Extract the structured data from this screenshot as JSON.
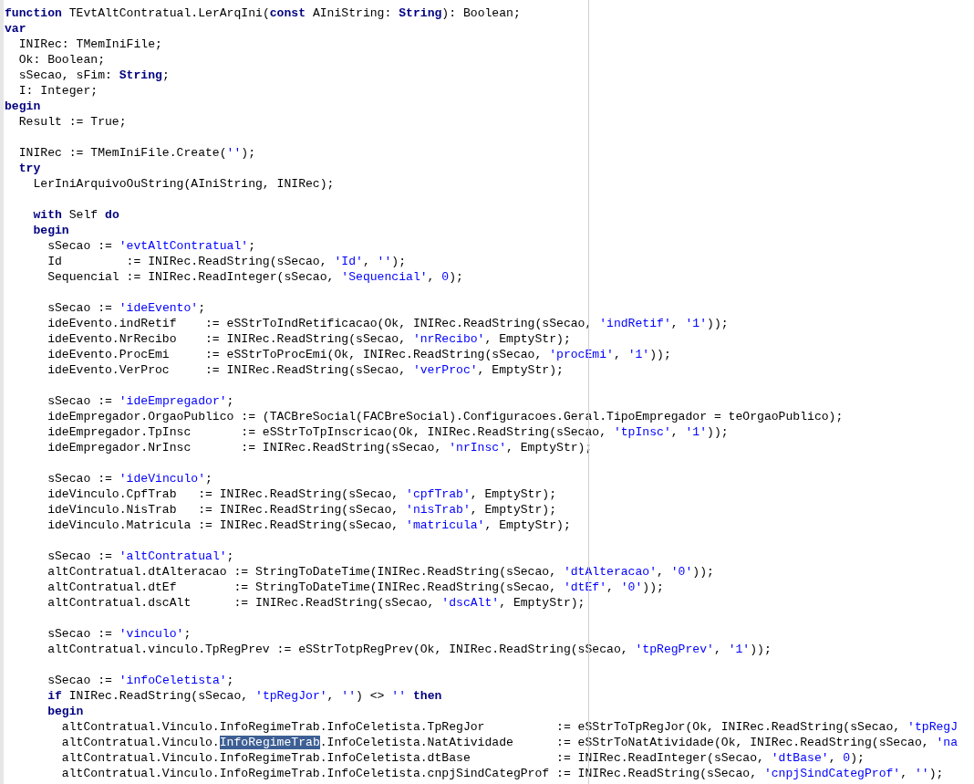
{
  "editor": {
    "lines": [
      {
        "kind": "code",
        "tokens": [
          {
            "kind": "keyword",
            "text": "function"
          },
          {
            "kind": "plain",
            "text": " TEvtAltContratual.LerArqIni("
          },
          {
            "kind": "keyword",
            "text": "const"
          },
          {
            "kind": "plain",
            "text": " AIniString: "
          },
          {
            "kind": "keyword",
            "text": "String"
          },
          {
            "kind": "plain",
            "text": "): Boolean;"
          }
        ]
      },
      {
        "kind": "code",
        "tokens": [
          {
            "kind": "keyword",
            "text": "var"
          }
        ]
      },
      {
        "kind": "code",
        "tokens": [
          {
            "kind": "plain",
            "text": "  INIRec: TMemIniFile;"
          }
        ]
      },
      {
        "kind": "code",
        "tokens": [
          {
            "kind": "plain",
            "text": "  Ok: Boolean;"
          }
        ]
      },
      {
        "kind": "code",
        "tokens": [
          {
            "kind": "plain",
            "text": "  sSecao, sFim: "
          },
          {
            "kind": "keyword",
            "text": "String"
          },
          {
            "kind": "plain",
            "text": ";"
          }
        ]
      },
      {
        "kind": "code",
        "tokens": [
          {
            "kind": "plain",
            "text": "  I: Integer;"
          }
        ]
      },
      {
        "kind": "code",
        "tokens": [
          {
            "kind": "keyword",
            "text": "begin"
          }
        ]
      },
      {
        "kind": "code",
        "tokens": [
          {
            "kind": "plain",
            "text": "  Result := True;"
          }
        ]
      },
      {
        "kind": "blank"
      },
      {
        "kind": "code",
        "tokens": [
          {
            "kind": "plain",
            "text": "  INIRec := TMemIniFile.Create("
          },
          {
            "kind": "string",
            "text": "''"
          },
          {
            "kind": "plain",
            "text": ");"
          }
        ]
      },
      {
        "kind": "code",
        "tokens": [
          {
            "kind": "keyword",
            "text": "  try"
          }
        ]
      },
      {
        "kind": "code",
        "tokens": [
          {
            "kind": "plain",
            "text": "    LerIniArquivoOuString(AIniString, INIRec);"
          }
        ]
      },
      {
        "kind": "blank"
      },
      {
        "kind": "code",
        "tokens": [
          {
            "kind": "keyword",
            "text": "    with"
          },
          {
            "kind": "plain",
            "text": " Self "
          },
          {
            "kind": "keyword",
            "text": "do"
          }
        ]
      },
      {
        "kind": "code",
        "tokens": [
          {
            "kind": "keyword",
            "text": "    begin"
          }
        ]
      },
      {
        "kind": "code",
        "tokens": [
          {
            "kind": "plain",
            "text": "      sSecao := "
          },
          {
            "kind": "string",
            "text": "'evtAltContratual'"
          },
          {
            "kind": "plain",
            "text": ";"
          }
        ]
      },
      {
        "kind": "code",
        "tokens": [
          {
            "kind": "plain",
            "text": "      Id         := INIRec.ReadString(sSecao, "
          },
          {
            "kind": "string",
            "text": "'Id'"
          },
          {
            "kind": "plain",
            "text": ", "
          },
          {
            "kind": "string",
            "text": "''"
          },
          {
            "kind": "plain",
            "text": ");"
          }
        ]
      },
      {
        "kind": "code",
        "tokens": [
          {
            "kind": "plain",
            "text": "      Sequencial := INIRec.ReadInteger(sSecao, "
          },
          {
            "kind": "string",
            "text": "'Sequencial'"
          },
          {
            "kind": "plain",
            "text": ", "
          },
          {
            "kind": "number",
            "text": "0"
          },
          {
            "kind": "plain",
            "text": ");"
          }
        ]
      },
      {
        "kind": "blank"
      },
      {
        "kind": "code",
        "tokens": [
          {
            "kind": "plain",
            "text": "      sSecao := "
          },
          {
            "kind": "string",
            "text": "'ideEvento'"
          },
          {
            "kind": "plain",
            "text": ";"
          }
        ]
      },
      {
        "kind": "code",
        "tokens": [
          {
            "kind": "plain",
            "text": "      ideEvento.indRetif    := eSStrToIndRetificacao(Ok, INIRec.ReadString(sSecao, "
          },
          {
            "kind": "string",
            "text": "'indRetif'"
          },
          {
            "kind": "plain",
            "text": ", "
          },
          {
            "kind": "string",
            "text": "'1'"
          },
          {
            "kind": "plain",
            "text": "));"
          }
        ]
      },
      {
        "kind": "code",
        "tokens": [
          {
            "kind": "plain",
            "text": "      ideEvento.NrRecibo    := INIRec.ReadString(sSecao, "
          },
          {
            "kind": "string",
            "text": "'nrRecibo'"
          },
          {
            "kind": "plain",
            "text": ", EmptyStr);"
          }
        ]
      },
      {
        "kind": "code",
        "tokens": [
          {
            "kind": "plain",
            "text": "      ideEvento.ProcEmi     := eSStrToProcEmi(Ok, INIRec.ReadString(sSecao, "
          },
          {
            "kind": "string",
            "text": "'procEmi'"
          },
          {
            "kind": "plain",
            "text": ", "
          },
          {
            "kind": "string",
            "text": "'1'"
          },
          {
            "kind": "plain",
            "text": "));"
          }
        ]
      },
      {
        "kind": "code",
        "tokens": [
          {
            "kind": "plain",
            "text": "      ideEvento.VerProc     := INIRec.ReadString(sSecao, "
          },
          {
            "kind": "string",
            "text": "'verProc'"
          },
          {
            "kind": "plain",
            "text": ", EmptyStr);"
          }
        ]
      },
      {
        "kind": "blank"
      },
      {
        "kind": "code",
        "tokens": [
          {
            "kind": "plain",
            "text": "      sSecao := "
          },
          {
            "kind": "string",
            "text": "'ideEmpregador'"
          },
          {
            "kind": "plain",
            "text": ";"
          }
        ]
      },
      {
        "kind": "code",
        "tokens": [
          {
            "kind": "plain",
            "text": "      ideEmpregador.OrgaoPublico := (TACBreSocial(FACBreSocial).Configuracoes.Geral.TipoEmpregador = teOrgaoPublico);"
          }
        ]
      },
      {
        "kind": "code",
        "tokens": [
          {
            "kind": "plain",
            "text": "      ideEmpregador.TpInsc       := eSStrToTpInscricao(Ok, INIRec.ReadString(sSecao, "
          },
          {
            "kind": "string",
            "text": "'tpInsc'"
          },
          {
            "kind": "plain",
            "text": ", "
          },
          {
            "kind": "string",
            "text": "'1'"
          },
          {
            "kind": "plain",
            "text": "));"
          }
        ]
      },
      {
        "kind": "code",
        "tokens": [
          {
            "kind": "plain",
            "text": "      ideEmpregador.NrInsc       := INIRec.ReadString(sSecao, "
          },
          {
            "kind": "string",
            "text": "'nrInsc'"
          },
          {
            "kind": "plain",
            "text": ", EmptyStr);"
          }
        ]
      },
      {
        "kind": "blank"
      },
      {
        "kind": "code",
        "tokens": [
          {
            "kind": "plain",
            "text": "      sSecao := "
          },
          {
            "kind": "string",
            "text": "'ideVinculo'"
          },
          {
            "kind": "plain",
            "text": ";"
          }
        ]
      },
      {
        "kind": "code",
        "tokens": [
          {
            "kind": "plain",
            "text": "      ideVinculo.CpfTrab   := INIRec.ReadString(sSecao, "
          },
          {
            "kind": "string",
            "text": "'cpfTrab'"
          },
          {
            "kind": "plain",
            "text": ", EmptyStr);"
          }
        ]
      },
      {
        "kind": "code",
        "tokens": [
          {
            "kind": "plain",
            "text": "      ideVinculo.NisTrab   := INIRec.ReadString(sSecao, "
          },
          {
            "kind": "string",
            "text": "'nisTrab'"
          },
          {
            "kind": "plain",
            "text": ", EmptyStr);"
          }
        ]
      },
      {
        "kind": "code",
        "tokens": [
          {
            "kind": "plain",
            "text": "      ideVinculo.Matricula := INIRec.ReadString(sSecao, "
          },
          {
            "kind": "string",
            "text": "'matricula'"
          },
          {
            "kind": "plain",
            "text": ", EmptyStr);"
          }
        ]
      },
      {
        "kind": "blank"
      },
      {
        "kind": "code",
        "tokens": [
          {
            "kind": "plain",
            "text": "      sSecao := "
          },
          {
            "kind": "string",
            "text": "'altContratual'"
          },
          {
            "kind": "plain",
            "text": ";"
          }
        ]
      },
      {
        "kind": "code",
        "tokens": [
          {
            "kind": "plain",
            "text": "      altContratual.dtAlteracao := StringToDateTime(INIRec.ReadString(sSecao, "
          },
          {
            "kind": "string",
            "text": "'dtAlteracao'"
          },
          {
            "kind": "plain",
            "text": ", "
          },
          {
            "kind": "string",
            "text": "'0'"
          },
          {
            "kind": "plain",
            "text": "));"
          }
        ]
      },
      {
        "kind": "code",
        "tokens": [
          {
            "kind": "plain",
            "text": "      altContratual.dtEf        := StringToDateTime(INIRec.ReadString(sSecao, "
          },
          {
            "kind": "string",
            "text": "'dtEf'"
          },
          {
            "kind": "plain",
            "text": ", "
          },
          {
            "kind": "string",
            "text": "'0'"
          },
          {
            "kind": "plain",
            "text": "));"
          }
        ]
      },
      {
        "kind": "code",
        "tokens": [
          {
            "kind": "plain",
            "text": "      altContratual.dscAlt      := INIRec.ReadString(sSecao, "
          },
          {
            "kind": "string",
            "text": "'dscAlt'"
          },
          {
            "kind": "plain",
            "text": ", EmptyStr);"
          }
        ]
      },
      {
        "kind": "blank"
      },
      {
        "kind": "code",
        "tokens": [
          {
            "kind": "plain",
            "text": "      sSecao := "
          },
          {
            "kind": "string",
            "text": "'vinculo'"
          },
          {
            "kind": "plain",
            "text": ";"
          }
        ]
      },
      {
        "kind": "code",
        "tokens": [
          {
            "kind": "plain",
            "text": "      altContratual.vinculo.TpRegPrev := eSStrTotpRegPrev(Ok, INIRec.ReadString(sSecao, "
          },
          {
            "kind": "string",
            "text": "'tpRegPrev'"
          },
          {
            "kind": "plain",
            "text": ", "
          },
          {
            "kind": "string",
            "text": "'1'"
          },
          {
            "kind": "plain",
            "text": "));"
          }
        ]
      },
      {
        "kind": "blank"
      },
      {
        "kind": "code",
        "tokens": [
          {
            "kind": "plain",
            "text": "      sSecao := "
          },
          {
            "kind": "string",
            "text": "'infoCeletista'"
          },
          {
            "kind": "plain",
            "text": ";"
          }
        ]
      },
      {
        "kind": "code",
        "tokens": [
          {
            "kind": "keyword",
            "text": "      if"
          },
          {
            "kind": "plain",
            "text": " INIRec.ReadString(sSecao, "
          },
          {
            "kind": "string",
            "text": "'tpRegJor'"
          },
          {
            "kind": "plain",
            "text": ", "
          },
          {
            "kind": "string",
            "text": "''"
          },
          {
            "kind": "plain",
            "text": ") <> "
          },
          {
            "kind": "string",
            "text": "''"
          },
          {
            "kind": "keyword",
            "text": " then"
          }
        ]
      },
      {
        "kind": "code",
        "tokens": [
          {
            "kind": "keyword",
            "text": "      begin"
          }
        ]
      },
      {
        "kind": "code",
        "tokens": [
          {
            "kind": "plain",
            "text": "        altContratual.Vinculo.InfoRegimeTrab.InfoCeletista.TpRegJor          := eSStrToTpRegJor(Ok, INIRec.ReadString(sSecao, "
          },
          {
            "kind": "string",
            "text": "'tpRegJ"
          }
        ]
      },
      {
        "kind": "code",
        "tokens": [
          {
            "kind": "plain",
            "text": "        altContratual.Vinculo."
          },
          {
            "kind": "selection",
            "text": "InfoRegimeTrab"
          },
          {
            "kind": "plain",
            "text": ".InfoCeletista.NatAtividade      := eSStrToNatAtividade(Ok, INIRec.ReadString(sSecao, "
          },
          {
            "kind": "string",
            "text": "'na"
          }
        ]
      },
      {
        "kind": "code",
        "tokens": [
          {
            "kind": "plain",
            "text": "        altContratual.Vinculo.InfoRegimeTrab.InfoCeletista.dtBase            := INIRec.ReadInteger(sSecao, "
          },
          {
            "kind": "string",
            "text": "'dtBase'"
          },
          {
            "kind": "plain",
            "text": ", "
          },
          {
            "kind": "number",
            "text": "0"
          },
          {
            "kind": "plain",
            "text": ");"
          }
        ]
      },
      {
        "kind": "code",
        "tokens": [
          {
            "kind": "plain",
            "text": "        altContratual.Vinculo.InfoRegimeTrab.InfoCeletista.cnpjSindCategProf := INIRec.ReadString(sSecao, "
          },
          {
            "kind": "string",
            "text": "'cnpjSindCategProf'"
          },
          {
            "kind": "plain",
            "text": ", "
          },
          {
            "kind": "string",
            "text": "''"
          },
          {
            "kind": "plain",
            "text": ");"
          }
        ]
      }
    ]
  }
}
